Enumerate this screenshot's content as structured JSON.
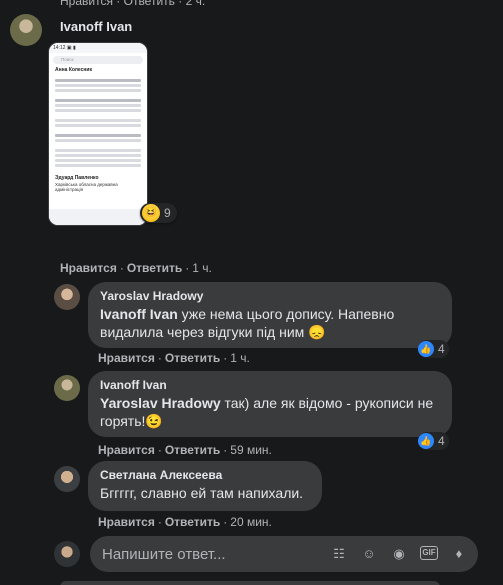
{
  "top_partial": "Нравится · Ответить · 2 ч.",
  "main_comment": {
    "author": "Ivanoff Ivan",
    "screenshot": {
      "post_author": "Анна Колесник",
      "search_label": "Поиск",
      "footer_author": "Эдуард Павленко",
      "footer_sub": "Харківська обласна державна адміністрація"
    },
    "reaction_count": "9",
    "like_label": "Нравится",
    "reply_label": "Ответить",
    "time": "1 ч."
  },
  "replies": [
    {
      "author": "Yaroslav Hradowy",
      "mention": "Ivanoff Ivan",
      "text": " уже нема цього допису. Напевно видалила через відгуки під ним 😞",
      "like_count": "4",
      "like_label": "Нравится",
      "reply_label": "Ответить",
      "time": "1 ч."
    },
    {
      "author": "Ivanoff Ivan",
      "mention": "Yaroslav Hradowy",
      "text": " так) але як відомо - рукописи не горять!😉",
      "like_count": "4",
      "like_label": "Нравится",
      "reply_label": "Ответить",
      "time": "59 мин."
    },
    {
      "author": "Светлана Алексеева",
      "text": "Бггггг, славно ей там напихали.",
      "like_label": "Нравится",
      "reply_label": "Ответить",
      "time": "20 мин."
    }
  ],
  "composer": {
    "placeholder": "Напишите ответ...",
    "icons": [
      "sticker-icon",
      "emoji-icon",
      "camera-icon",
      "gif-icon",
      "sticker-pack-icon"
    ]
  },
  "colors": {
    "background": "#18191a",
    "bubble": "#3a3b3c",
    "like_blue": "#2d88ff",
    "muted_text": "#b0b3b8"
  }
}
